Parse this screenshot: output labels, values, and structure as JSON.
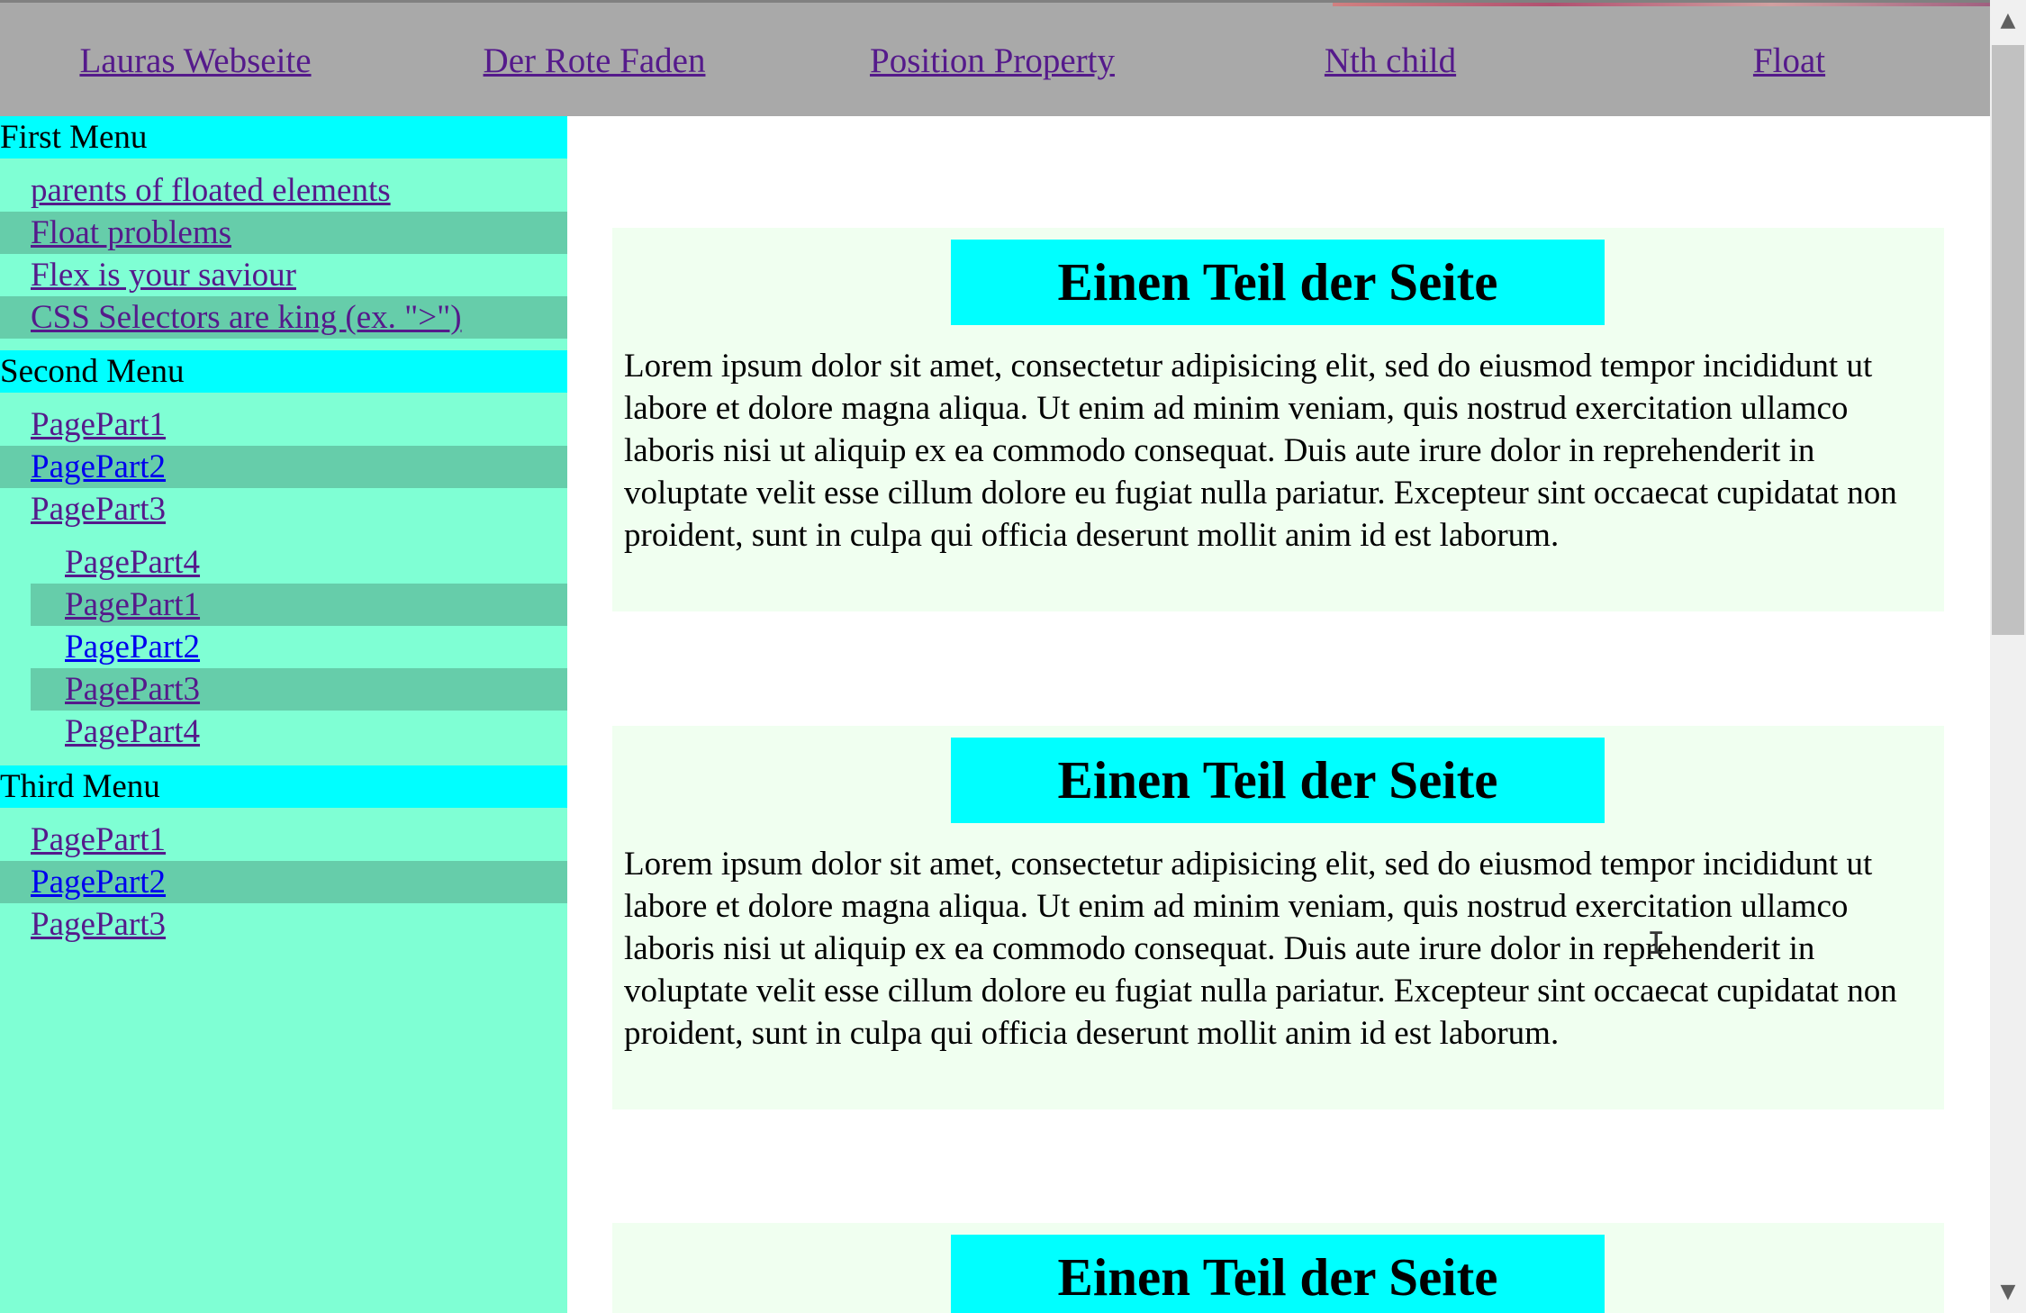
{
  "nav": {
    "items": [
      {
        "label": "Lauras Webseite"
      },
      {
        "label": "Der Rote Faden"
      },
      {
        "label": "Position Property"
      },
      {
        "label": "Nth child"
      },
      {
        "label": "Float"
      }
    ]
  },
  "sidebar": {
    "first_menu": {
      "title": "First Menu",
      "items": [
        {
          "label": "parents of floated elements"
        },
        {
          "label": "Float problems"
        },
        {
          "label": "Flex is your saviour"
        },
        {
          "label": "CSS Selectors are king (ex. \">\")"
        }
      ]
    },
    "second_menu": {
      "title": "Second Menu",
      "items": [
        {
          "label": "PagePart1"
        },
        {
          "label": "PagePart2"
        },
        {
          "label": "PagePart3"
        }
      ],
      "submenu": [
        {
          "label": "PagePart4"
        },
        {
          "label": "PagePart1"
        },
        {
          "label": "PagePart2"
        },
        {
          "label": "PagePart3"
        },
        {
          "label": "PagePart4"
        }
      ]
    },
    "third_menu": {
      "title": "Third Menu",
      "items": [
        {
          "label": "PagePart1"
        },
        {
          "label": "PagePart2"
        },
        {
          "label": "PagePart3"
        }
      ]
    }
  },
  "main": {
    "cards": [
      {
        "title": "Einen Teil der Seite",
        "text": "Lorem ipsum dolor sit amet, consectetur adipisicing elit, sed do eiusmod tempor incididunt ut labore et dolore magna aliqua. Ut enim ad minim veniam, quis nostrud exercitation ullamco laboris nisi ut aliquip ex ea commodo consequat. Duis aute irure dolor in reprehenderit in voluptate velit esse cillum dolore eu fugiat nulla pariatur. Excepteur sint occaecat cupidatat non proident, sunt in culpa qui officia deserunt mollit anim id est laborum."
      },
      {
        "title": "Einen Teil der Seite",
        "text": "Lorem ipsum dolor sit amet, consectetur adipisicing elit, sed do eiusmod tempor incididunt ut labore et dolore magna aliqua. Ut enim ad minim veniam, quis nostrud exercitation ullamco laboris nisi ut aliquip ex ea commodo consequat. Duis aute irure dolor in reprehenderit in voluptate velit esse cillum dolore eu fugiat nulla pariatur. Excepteur sint occaecat cupidatat non proident, sunt in culpa qui officia deserunt mollit anim id est laborum."
      },
      {
        "title": "Einen Teil der Seite"
      }
    ]
  },
  "colors": {
    "nav_bg": "#a9a9a9",
    "sidebar_bg": "#7fffd4",
    "sidebar_alt_row": "#66cdaa",
    "menu_head_bg": "#00ffff",
    "card_bg": "#f0fff0",
    "card_title_bg": "#00ffff",
    "visited_link": "#551a8b",
    "unvisited_link": "#0000ee"
  },
  "scrollbar": {
    "up_icon": "chevron-up-icon",
    "down_icon": "chevron-down-icon"
  }
}
